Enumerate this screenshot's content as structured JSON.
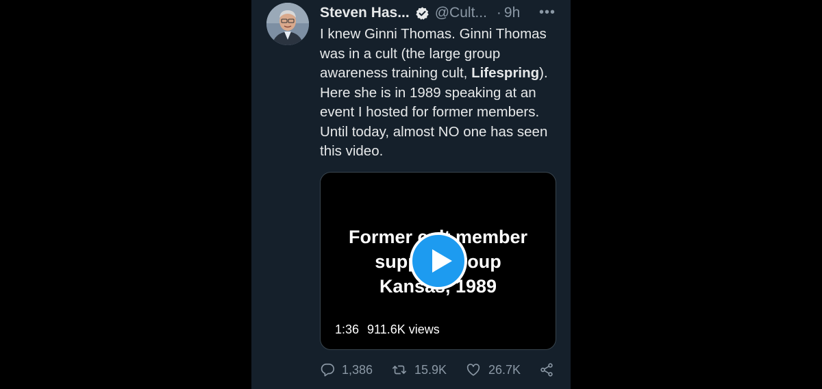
{
  "tweet": {
    "author_name": "Steven Has...",
    "handle": "@Cult...",
    "separator": "·",
    "time": "9h",
    "more_label": "•••",
    "text_line_1": "I knew Ginni Thomas. Ginni Thomas was in a cult (the large group awareness training cult,",
    "text_bold": "Lifespring",
    "text_line_2": "). Here she is in 1989 speaking at an event I hosted for former members. Until today, almost NO one has seen this video."
  },
  "video": {
    "title_line_1": "Former cult member",
    "title_line_2": "support group",
    "title_line_3": "Kansas, 1989",
    "duration": "1:36",
    "views": "911.6K views"
  },
  "actions": {
    "replies": "1,386",
    "retweets": "15.9K",
    "likes": "26.7K"
  },
  "icons": {
    "verified": "verified-badge-icon",
    "reply": "reply-icon",
    "retweet": "retweet-icon",
    "like": "heart-icon",
    "share": "share-icon",
    "play": "play-icon"
  },
  "colors": {
    "background": "#15202b",
    "accent": "#1d9bf0",
    "text": "#e7e9ea",
    "muted": "#8b98a5"
  }
}
